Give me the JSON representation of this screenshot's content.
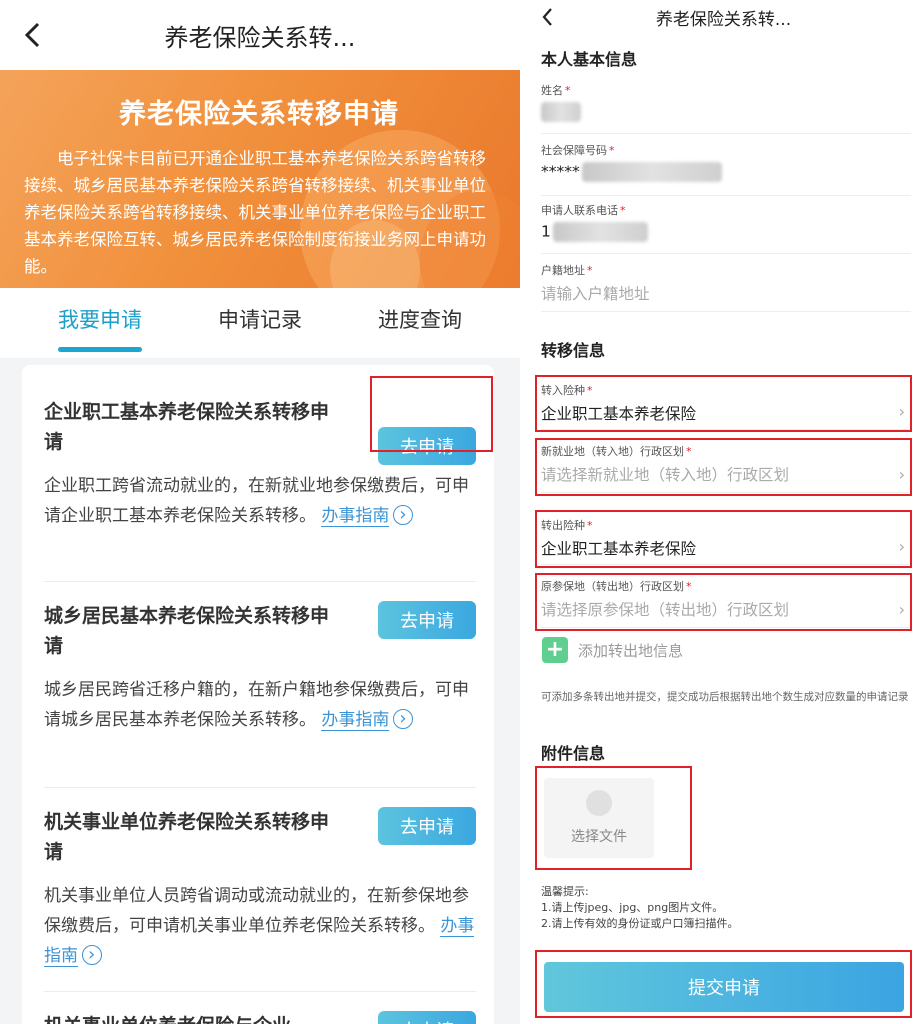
{
  "left": {
    "header": {
      "title": "养老保险关系转..."
    },
    "banner": {
      "title": "养老保险关系转移申请",
      "description": "电子社保卡目前已开通企业职工基本养老保险关系跨省转移接续、城乡居民基本养老保险关系跨省转移接续、机关事业单位养老保险关系跨省转移接续、机关事业单位养老保险与企业职工基本养老保险互转、城乡居民养老保险制度衔接业务网上申请功能。"
    },
    "tabs": [
      "我要申请",
      "申请记录",
      "进度查询"
    ],
    "items": [
      {
        "title": "企业职工基本养老保险关系转移申请",
        "button": "去申请",
        "desc": "企业职工跨省流动就业的，在新就业地参保缴费后，可申请企业职工基本养老保险关系转移。",
        "guide": "办事指南"
      },
      {
        "title": "城乡居民基本养老保险关系转移申请",
        "button": "去申请",
        "desc": "城乡居民跨省迁移户籍的，在新户籍地参保缴费后，可申请城乡居民基本养老保险关系转移。",
        "guide": "办事指南"
      },
      {
        "title": "机关事业单位养老保险关系转移申请",
        "button": "去申请",
        "desc": "机关事业单位人员跨省调动或流动就业的，在新参保地参保缴费后，可申请机关事业单位养老保险关系转移。",
        "guide": "办事指南"
      },
      {
        "title": "机关事业单位养老保险与企业",
        "button": "去申请"
      }
    ]
  },
  "right": {
    "header": {
      "title": "养老保险关系转..."
    },
    "basic_section": "本人基本信息",
    "fields": {
      "name": {
        "label": "姓名"
      },
      "ssn": {
        "label": "社会保障号码",
        "value": "*****"
      },
      "phone": {
        "label": "申请人联系电话",
        "value": "1"
      },
      "address": {
        "label": "户籍地址",
        "placeholder": "请输入户籍地址"
      }
    },
    "transfer_section": "转移信息",
    "transfer_fields": {
      "in_type": {
        "label": "转入险种",
        "value": "企业职工基本养老保险"
      },
      "in_region": {
        "label": "新就业地（转入地）行政区划",
        "placeholder": "请选择新就业地（转入地）行政区划"
      },
      "out_type": {
        "label": "转出险种",
        "value": "企业职工基本养老保险"
      },
      "out_region": {
        "label": "原参保地（转出地）行政区划",
        "placeholder": "请选择原参保地（转出地）行政区划"
      }
    },
    "add_out": "添加转出地信息",
    "note": "可添加多条转出地并提交，提交成功后根据转出地个数生成对应数量的申请记录",
    "attach_section": "附件信息",
    "file_button": "选择文件",
    "tips": {
      "title": "温馨提示:",
      "line1": "1.请上传jpeg、jpg、png图片文件。",
      "line2": "2.请上传有效的身份证或户口簿扫描件。"
    },
    "submit": "提交申请"
  },
  "colors": {
    "accent": "#1aa6cf",
    "required": "#e0212a",
    "highlight_box": "#e0212a",
    "banner": "#f1903c",
    "add_icon": "#5fcf8f"
  }
}
